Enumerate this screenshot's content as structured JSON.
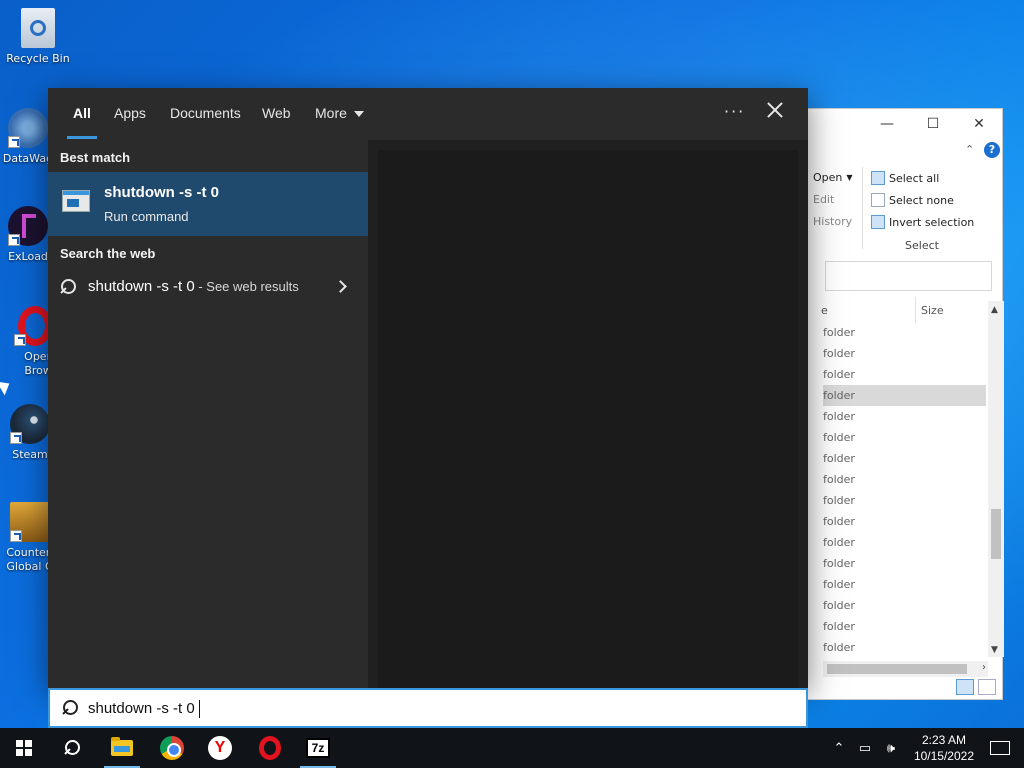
{
  "desktop": {
    "icons": [
      {
        "label": "Recycle Bin",
        "icon": "recycle-bin-icon"
      },
      {
        "label": "DataWag",
        "icon": "datawag-icon"
      },
      {
        "label": "ExLoad",
        "icon": "exload-icon"
      },
      {
        "label": "Opera Brows",
        "label2": "Brows",
        "icon": "opera-icon"
      },
      {
        "label": "Steam",
        "icon": "steam-icon"
      },
      {
        "label": "Counter-",
        "label2": "Global O",
        "icon": "csgo-icon"
      }
    ]
  },
  "explorer": {
    "ribbon": {
      "open": "Open",
      "edit": "Edit",
      "history": "History",
      "select_all": "Select all",
      "select_none": "Select none",
      "invert_selection": "Invert selection",
      "group_label": "Select"
    },
    "columns": {
      "partial": "e",
      "size": "Size"
    },
    "rows": [
      "folder",
      "folder",
      "folder",
      "folder",
      "folder",
      "folder",
      "folder",
      "folder",
      "folder",
      "folder",
      "folder",
      "folder",
      "folder",
      "folder",
      "folder",
      "folder"
    ],
    "selected_row": 3
  },
  "search": {
    "tabs": [
      "All",
      "Apps",
      "Documents",
      "Web",
      "More"
    ],
    "active_tab": "All",
    "best_match_label": "Best match",
    "best_match": {
      "title": "shutdown -s -t 0",
      "subtitle": "Run command"
    },
    "search_web_label": "Search the web",
    "web_result": {
      "query": "shutdown -s -t 0",
      "suffix": " - See web results"
    },
    "query": "shutdown -s -t 0"
  },
  "taskbar": {
    "apps": [
      "start",
      "search",
      "file-explorer",
      "chrome",
      "yandex",
      "opera",
      "7-zip"
    ],
    "time": "2:23 AM",
    "date": "10/15/2022"
  }
}
